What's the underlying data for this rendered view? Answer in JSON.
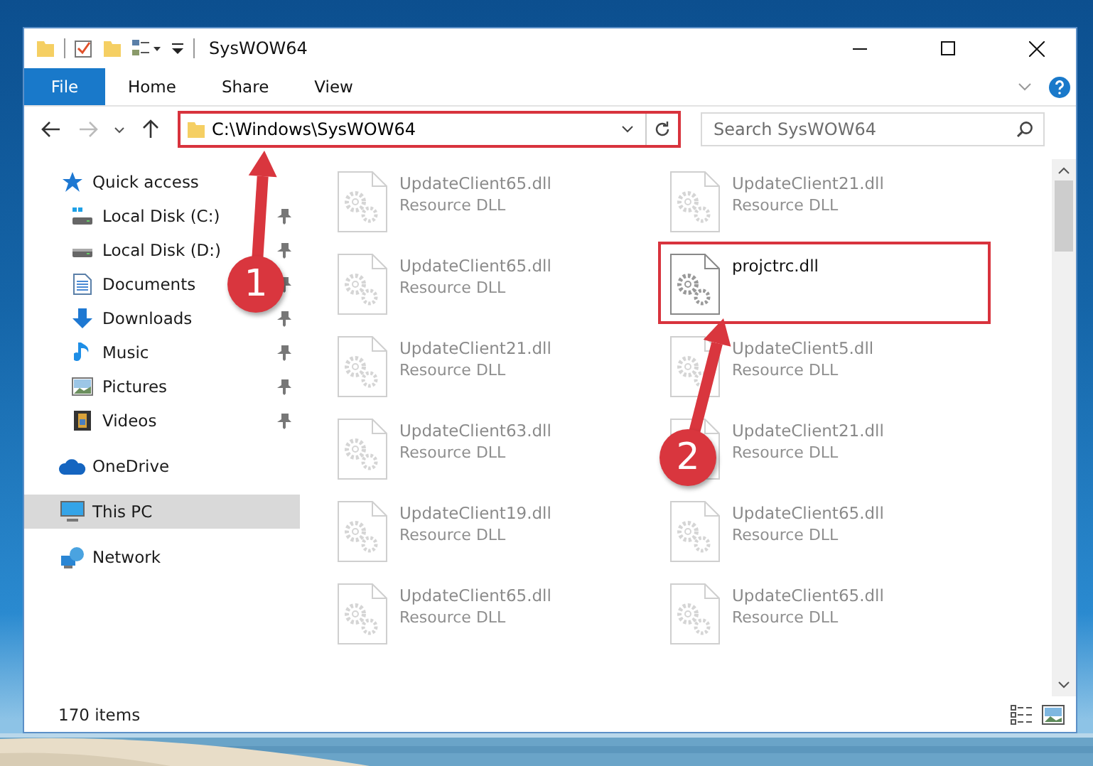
{
  "window": {
    "title": "SysWOW64"
  },
  "ribbon": {
    "file_menu": "File",
    "tabs": [
      "Home",
      "Share",
      "View"
    ]
  },
  "address": {
    "path": "C:\\Windows\\SysWOW64",
    "highlighted": true
  },
  "search": {
    "placeholder": "Search SysWOW64"
  },
  "sidebar": {
    "items": [
      {
        "label": "Quick access",
        "kind": "star",
        "selected": false,
        "children": [
          {
            "label": "Local Disk (C:)",
            "kind": "disk-c",
            "pinned": true,
            "selected": false
          },
          {
            "label": "Local Disk (D:)",
            "kind": "disk",
            "pinned": true,
            "selected": false
          },
          {
            "label": "Documents",
            "kind": "document",
            "pinned": true,
            "selected": false
          },
          {
            "label": "Downloads",
            "kind": "download",
            "pinned": true,
            "selected": false
          },
          {
            "label": "Music",
            "kind": "music",
            "pinned": true,
            "selected": false
          },
          {
            "label": "Pictures",
            "kind": "pictures",
            "pinned": true,
            "selected": false
          },
          {
            "label": "Videos",
            "kind": "video",
            "pinned": true,
            "selected": false
          }
        ]
      },
      {
        "label": "OneDrive",
        "kind": "cloud",
        "selected": false
      },
      {
        "label": "This PC",
        "kind": "pc",
        "selected": true
      },
      {
        "label": "Network",
        "kind": "network",
        "selected": false
      }
    ]
  },
  "files": [
    {
      "name": "UpdateClient65.dll",
      "type": "Resource DLL",
      "highlighted": false
    },
    {
      "name": "UpdateClient21.dll",
      "type": "Resource DLL",
      "highlighted": false
    },
    {
      "name": "UpdateClient65.dll",
      "type": "Resource DLL",
      "highlighted": false
    },
    {
      "name": "projctrc.dll",
      "highlighted": true
    },
    {
      "name": "UpdateClient21.dll",
      "type": "Resource DLL",
      "highlighted": false
    },
    {
      "name": "UpdateClient5.dll",
      "type": "Resource DLL",
      "highlighted": false
    },
    {
      "name": "UpdateClient63.dll",
      "type": "Resource DLL",
      "highlighted": false
    },
    {
      "name": "UpdateClient21.dll",
      "type": "Resource DLL",
      "highlighted": false
    },
    {
      "name": "UpdateClient19.dll",
      "type": "Resource DLL",
      "highlighted": false
    },
    {
      "name": "UpdateClient65.dll",
      "type": "Resource DLL",
      "highlighted": false
    },
    {
      "name": "UpdateClient65.dll",
      "type": "Resource DLL",
      "highlighted": false
    },
    {
      "name": "UpdateClient65.dll",
      "type": "Resource DLL",
      "highlighted": false
    }
  ],
  "annotations": [
    {
      "number": "1"
    },
    {
      "number": "2"
    }
  ],
  "status_bar": {
    "item_count": "170 items"
  }
}
